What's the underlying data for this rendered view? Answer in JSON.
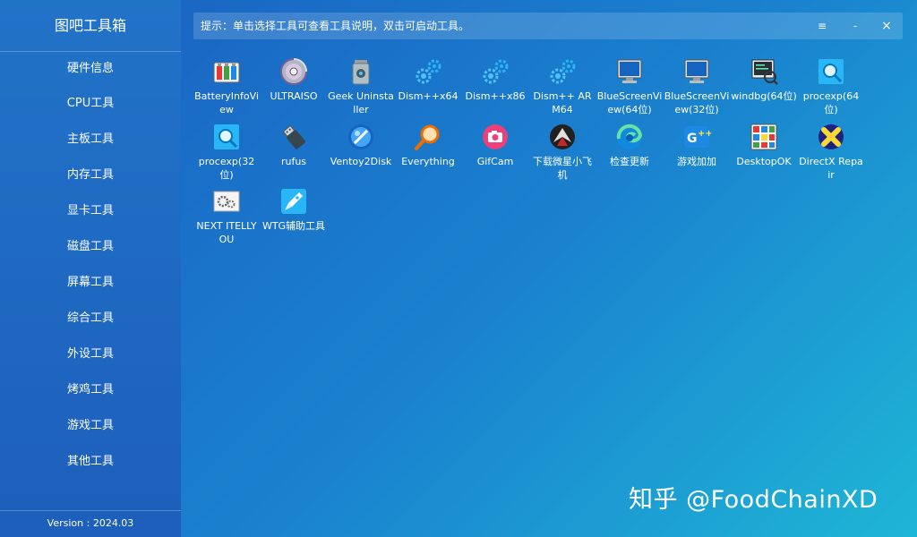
{
  "app": {
    "title": "图吧工具箱",
    "version": "Version : 2024.03"
  },
  "sidebar": {
    "items": [
      {
        "label": "硬件信息"
      },
      {
        "label": "CPU工具"
      },
      {
        "label": "主板工具"
      },
      {
        "label": "内存工具"
      },
      {
        "label": "显卡工具"
      },
      {
        "label": "磁盘工具"
      },
      {
        "label": "屏幕工具"
      },
      {
        "label": "综合工具"
      },
      {
        "label": "外设工具"
      },
      {
        "label": "烤鸡工具"
      },
      {
        "label": "游戏工具"
      },
      {
        "label": "其他工具"
      }
    ]
  },
  "topbar": {
    "hint": "提示：单击选择工具可查看工具说明，双击可启动工具。",
    "menu_glyph": "≡",
    "minimize_glyph": "-",
    "maximize_glyph": "□",
    "close_glyph": "×"
  },
  "tools": [
    {
      "label": "BatteryInfoView",
      "icon": "battery-icon"
    },
    {
      "label": "ULTRAISO",
      "icon": "disc-icon"
    },
    {
      "label": "Geek Uninstaller",
      "icon": "trash-can-icon"
    },
    {
      "label": "Dism++x64",
      "icon": "gears-icon"
    },
    {
      "label": "Dism++x86",
      "icon": "gears-icon"
    },
    {
      "label": "Dism++ ARM64",
      "icon": "gears-icon"
    },
    {
      "label": "BlueScreenView(64位)",
      "icon": "monitor-icon"
    },
    {
      "label": "BlueScreenView(32位)",
      "icon": "monitor-icon"
    },
    {
      "label": "windbg(64位)",
      "icon": "debugger-icon"
    },
    {
      "label": "procexp(64位)",
      "icon": "process-search-icon"
    },
    {
      "label": "procexp(32位)",
      "icon": "process-search-icon"
    },
    {
      "label": "rufus",
      "icon": "usb-drive-icon"
    },
    {
      "label": "Ventoy2Disk",
      "icon": "ventoy-icon"
    },
    {
      "label": "Everything",
      "icon": "magnifier-icon"
    },
    {
      "label": "GifCam",
      "icon": "camera-icon"
    },
    {
      "label": "下载微星小飞机",
      "icon": "afterburner-icon"
    },
    {
      "label": "检查更新",
      "icon": "edge-icon"
    },
    {
      "label": "游戏加加",
      "icon": "game-plus-icon"
    },
    {
      "label": "DesktopOK",
      "icon": "desktop-grid-icon"
    },
    {
      "label": "DirectX Repair",
      "icon": "directx-icon"
    },
    {
      "label": "NEXT ITELLYOU",
      "icon": "gear-window-icon"
    },
    {
      "label": "WTG辅助工具",
      "icon": "rocket-icon"
    }
  ],
  "watermark": "知乎 @FoodChainXD",
  "colors": {
    "background_start": "#1a5fc0",
    "background_end": "#1eb6d6",
    "sidebar": "#1f68c2",
    "text": "#ffffff"
  }
}
